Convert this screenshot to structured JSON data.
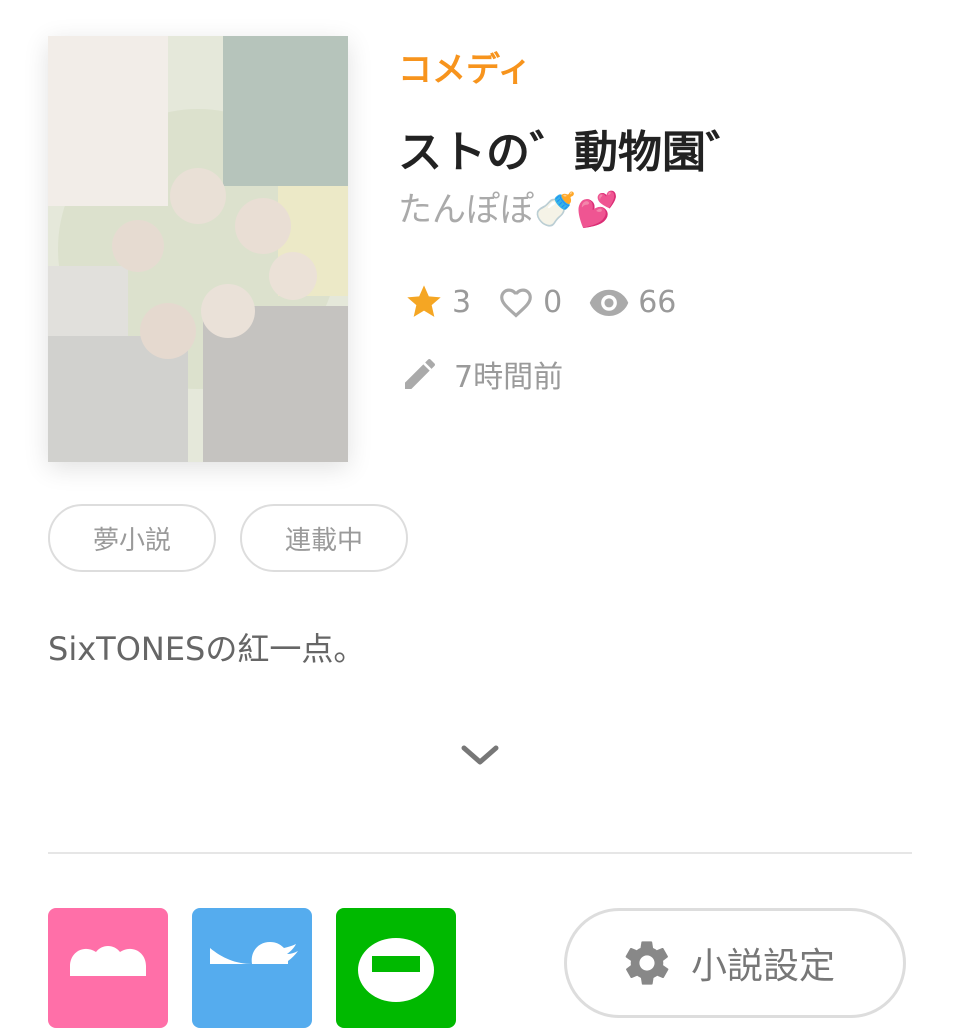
{
  "novel": {
    "genre": "コメディ",
    "title": "ストの゛動物園゛",
    "author": "たんぽぽ🍼💕",
    "stats": {
      "stars": "3",
      "likes": "0",
      "views": "66"
    },
    "updated": "7時間前",
    "tags": [
      "夢小説",
      "連載中"
    ],
    "description": "SixTONESの紅一点。"
  },
  "share": {
    "buttons": [
      "share-app",
      "twitter",
      "line"
    ],
    "colors": {
      "app": "#ff6fa8",
      "twitter": "#55acee",
      "line": "#00b900"
    }
  },
  "settings_button": {
    "label": "小説設定"
  },
  "colors": {
    "genre": "#f7941d",
    "star": "#f5a623"
  },
  "icons": {
    "stars": "star-icon",
    "likes": "heart-icon",
    "views": "eye-icon",
    "updated": "pencil-icon",
    "expand": "chevron-down-icon",
    "settings": "gear-icon"
  }
}
